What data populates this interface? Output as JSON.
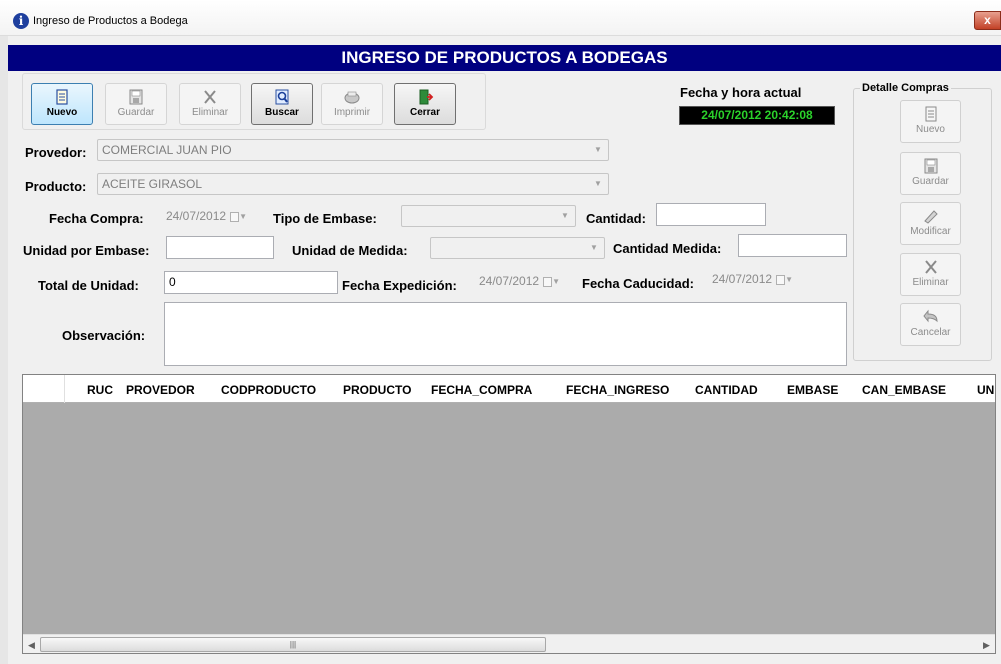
{
  "window": {
    "title": "Ingreso de Productos a Bodega",
    "close_label": "x"
  },
  "banner": {
    "title": "INGRESO DE PRODUCTOS A BODEGAS"
  },
  "toolbar": {
    "nuevo": "Nuevo",
    "guardar": "Guardar",
    "eliminar": "Eliminar",
    "buscar": "Buscar",
    "imprimir": "Imprimir",
    "cerrar": "Cerrar"
  },
  "clock": {
    "label": "Fecha y hora actual",
    "value": "24/07/2012 20:42:08"
  },
  "detalle": {
    "legend": "Detalle Compras",
    "nuevo": "Nuevo",
    "guardar": "Guardar",
    "modificar": "Modificar",
    "eliminar": "Eliminar",
    "cancelar": "Cancelar"
  },
  "form": {
    "provedor_label": "Provedor:",
    "provedor_value": "COMERCIAL JUAN PIO",
    "producto_label": "Producto:",
    "producto_value": "ACEITE GIRASOL",
    "fecha_compra_label": "Fecha Compra:",
    "fecha_compra_value": "24/07/2012",
    "tipo_embase_label": "Tipo de Embase:",
    "tipo_embase_value": "",
    "cantidad_label": "Cantidad:",
    "cantidad_value": "",
    "unidad_embase_label": "Unidad por Embase:",
    "unidad_embase_value": "",
    "unidad_medida_label": "Unidad de Medida:",
    "unidad_medida_value": "",
    "cantidad_medida_label": "Cantidad Medida:",
    "cantidad_medida_value": "",
    "total_unidad_label": "Total de Unidad:",
    "total_unidad_value": "0",
    "fecha_expedicion_label": "Fecha Expedición:",
    "fecha_expedicion_value": "24/07/2012",
    "fecha_caducidad_label": "Fecha Caducidad:",
    "fecha_caducidad_value": "24/07/2012",
    "observacion_label": "Observación:",
    "observacion_value": ""
  },
  "grid": {
    "columns": [
      "RUC",
      "PROVEDOR",
      "CODPRODUCTO",
      "PRODUCTO",
      "FECHA_COMPRA",
      "FECHA_INGRESO",
      "CANTIDAD",
      "EMBASE",
      "CAN_EMBASE",
      "UNI"
    ],
    "rows": []
  },
  "colors": {
    "banner": "#000080",
    "clock_text": "#2bd22b",
    "grid_bg": "#ababab"
  },
  "icons": [
    "info-icon",
    "new-document-icon",
    "save-icon",
    "delete-x-icon",
    "search-icon",
    "print-icon",
    "exit-door-icon",
    "undo-arrow-icon"
  ]
}
